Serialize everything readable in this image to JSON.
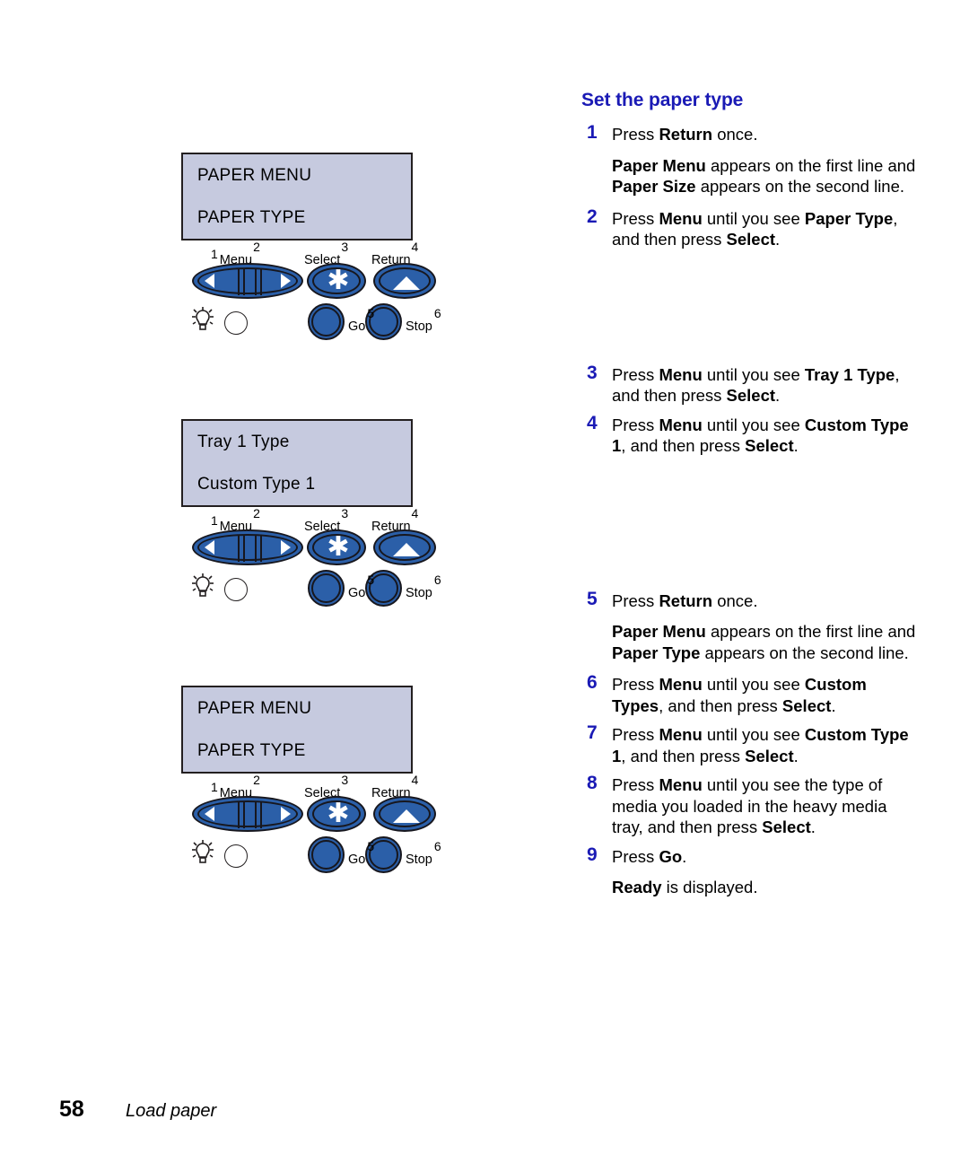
{
  "heading": "Set the paper type",
  "page_footer": {
    "page_number": "58",
    "section_title": "Load paper"
  },
  "colors": {
    "heading_blue": "#1a1ab5",
    "step_number_blue": "#1a1ab5",
    "button_blue": "#2b5fa8",
    "lcd_background": "#c6cadf",
    "outline": "#17171e"
  },
  "panels": [
    {
      "name": "panel-paper-menu-paper-type-top",
      "display": {
        "line1": "PAPER MENU",
        "line2": "PAPER TYPE"
      }
    },
    {
      "name": "panel-tray-1-type",
      "display": {
        "line1": "Tray 1 Type",
        "line2": "Custom Type 1"
      }
    },
    {
      "name": "panel-paper-menu-paper-type-bottom",
      "display": {
        "line1": "PAPER MENU",
        "line2": "PAPER TYPE"
      }
    }
  ],
  "control_panel": {
    "buttons": [
      {
        "label": "Menu",
        "num_left": "1",
        "num_right": "2",
        "icon": "left-right-arrows-icon"
      },
      {
        "label": "Select",
        "num_right": "3",
        "icon": "asterisk-icon"
      },
      {
        "label": "Return",
        "num_right": "4",
        "icon": "up-triangle-icon"
      },
      {
        "label": "Go",
        "num_right": "5",
        "icon": "round-button-icon"
      },
      {
        "label": "Stop",
        "num_right": "6",
        "icon": "round-button-icon"
      }
    ],
    "indicator": {
      "icon": "light-bulb-icon",
      "led": "indicator-led"
    }
  },
  "steps": [
    {
      "num": "1",
      "text_html": "Press <b>Return</b> once.",
      "note_html": "<b>Paper Menu</b> appears on the first line and <b>Paper Size</b> appears on the second line."
    },
    {
      "num": "2",
      "text_html": "Press <b>Menu</b> until you see <b>Paper Type</b>, and then press <b>Select</b>."
    },
    {
      "num": "3",
      "text_html": "Press <b>Menu</b> until you see <b>Tray 1 Type</b>, and then press <b>Select</b>."
    },
    {
      "num": "4",
      "text_html": "Press <b>Menu</b> until you see <b>Custom Type 1</b>, and then press <b>Select</b>."
    },
    {
      "num": "5",
      "text_html": "Press <b>Return</b> once.",
      "note_html": "<b>Paper Menu</b> appears on the first line and <b>Paper Type</b> appears on the second line."
    },
    {
      "num": "6",
      "text_html": "Press <b>Menu</b> until you see <b>Custom Types</b>, and then press <b>Select</b>."
    },
    {
      "num": "7",
      "text_html": "Press <b>Menu</b> until you see <b>Custom Type 1</b>, and then press <b>Select</b>."
    },
    {
      "num": "8",
      "text_html": "Press <b>Menu</b> until you see the type of media you loaded in the heavy media tray, and then press <b>Select</b>."
    },
    {
      "num": "9",
      "text_html": "Press <b>Go</b>.",
      "note_html": "<b>Ready</b> is displayed."
    }
  ]
}
